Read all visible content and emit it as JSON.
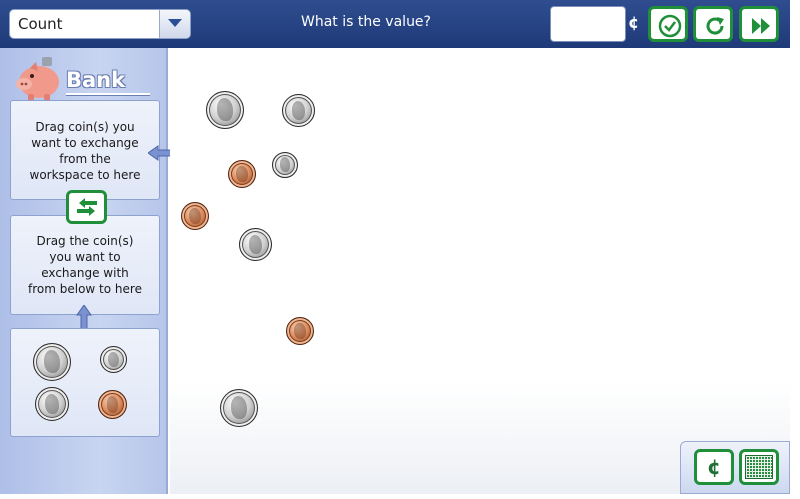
{
  "toolbar": {
    "mode_value": "Count",
    "question": "What is the value?",
    "answer_value": "",
    "cents_symbol": "¢"
  },
  "sidebar": {
    "title": "Bank",
    "panel1_lines": [
      "Drag coin(s) you",
      "want to exchange",
      "from the",
      "workspace to here"
    ],
    "panel2_lines": [
      "Drag the coin(s)",
      "you want to",
      "exchange with",
      "from below to here"
    ]
  },
  "bank_coins": [
    "quarter",
    "dime",
    "nickel",
    "penny"
  ],
  "workspace_coins": [
    "quarter",
    "nickel",
    "penny",
    "dime",
    "penny",
    "nickel",
    "penny",
    "quarter"
  ],
  "tools": {
    "cent_label": "¢"
  },
  "colors": {
    "topbar": "#264384",
    "button_border": "#1f8f3a",
    "sidebar": "#c8d5f1"
  }
}
